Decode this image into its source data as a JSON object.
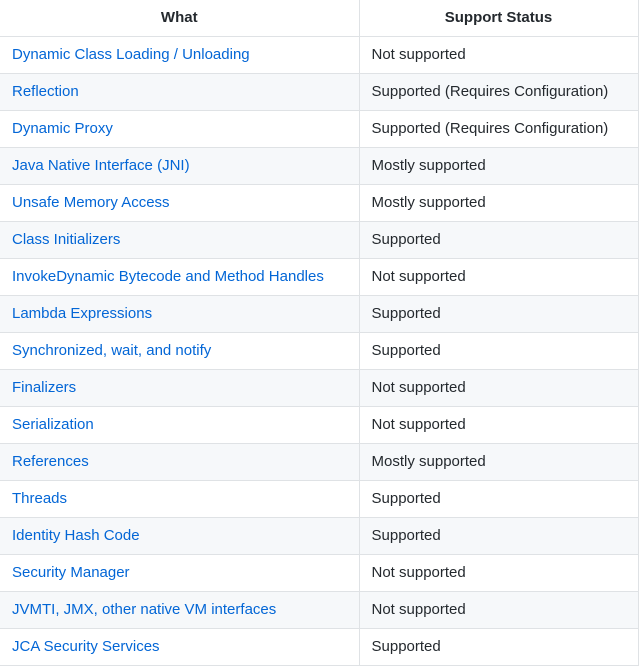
{
  "table": {
    "headers": {
      "what": "What",
      "status": "Support Status"
    },
    "rows": [
      {
        "what": "Dynamic Class Loading / Unloading",
        "status": "Not supported"
      },
      {
        "what": "Reflection",
        "status": "Supported (Requires Configuration)"
      },
      {
        "what": "Dynamic Proxy",
        "status": "Supported (Requires Configuration)"
      },
      {
        "what": "Java Native Interface (JNI)",
        "status": "Mostly supported"
      },
      {
        "what": "Unsafe Memory Access",
        "status": "Mostly supported"
      },
      {
        "what": "Class Initializers",
        "status": "Supported"
      },
      {
        "what": "InvokeDynamic Bytecode and Method Handles",
        "status": "Not supported"
      },
      {
        "what": "Lambda Expressions",
        "status": "Supported"
      },
      {
        "what": "Synchronized, wait, and notify",
        "status": "Supported"
      },
      {
        "what": "Finalizers",
        "status": "Not supported"
      },
      {
        "what": "Serialization",
        "status": "Not supported"
      },
      {
        "what": "References",
        "status": "Mostly supported"
      },
      {
        "what": "Threads",
        "status": "Supported"
      },
      {
        "what": "Identity Hash Code",
        "status": "Supported"
      },
      {
        "what": "Security Manager",
        "status": "Not supported"
      },
      {
        "what": "JVMTI, JMX, other native VM interfaces",
        "status": "Not supported"
      },
      {
        "what": "JCA Security Services",
        "status": "Supported"
      }
    ]
  },
  "colors": {
    "link": "#0366d6",
    "text": "#24292e",
    "stripe": "#f6f8fa",
    "border": "#dfe2e5"
  }
}
